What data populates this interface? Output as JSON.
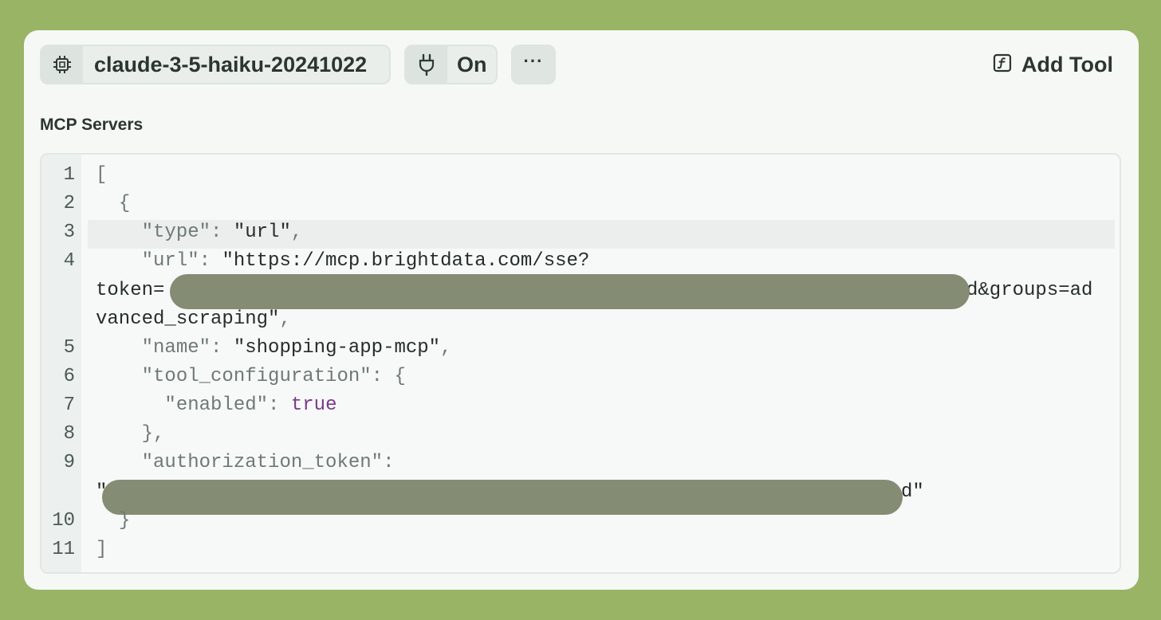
{
  "toolbar": {
    "model_name": "claude-3-5-haiku-20241022",
    "toggle_label": "On",
    "more_label": "···",
    "add_tool_label": "Add Tool"
  },
  "section": {
    "title": "MCP Servers"
  },
  "editor": {
    "line_numbers": [
      "1",
      "2",
      "3",
      "4",
      "5",
      "6",
      "7",
      "8",
      "9",
      "10",
      "11"
    ],
    "code": {
      "l1": "[",
      "l2_indent": "  ",
      "l2": "{",
      "l3_key": "\"type\"",
      "l3_colon": ": ",
      "l3_val": "\"url\"",
      "l3_comma": ",",
      "l4_key": "\"url\"",
      "l4_colon": ": ",
      "l4_val": "\"https://mcp.brightdata.com/sse?",
      "l4b_prefix": "token=",
      "l4b_suffix": "d&groups=ad",
      "l4c": "vanced_scraping\"",
      "l4c_comma": ",",
      "l5_key": "\"name\"",
      "l5_colon": ": ",
      "l5_val": "\"shopping-app-mcp\"",
      "l5_comma": ",",
      "l6_key": "\"tool_configuration\"",
      "l6_colon": ": {",
      "l7_key": "\"enabled\"",
      "l7_colon": ": ",
      "l7_val": "true",
      "l8": "},",
      "l9_key": "\"authorization_token\"",
      "l9_colon": ":",
      "l9b_prefix": "\"",
      "l9b_suffix": "d\"",
      "l10": "}",
      "l11": "]"
    }
  },
  "colors": {
    "background": "#99b465",
    "card": "#f6f8f6",
    "redaction": "#858c74",
    "boolean": "#7a3a8c"
  },
  "icons": {
    "model": "chip-icon",
    "toggle": "plug-icon",
    "add_tool": "function-icon"
  }
}
